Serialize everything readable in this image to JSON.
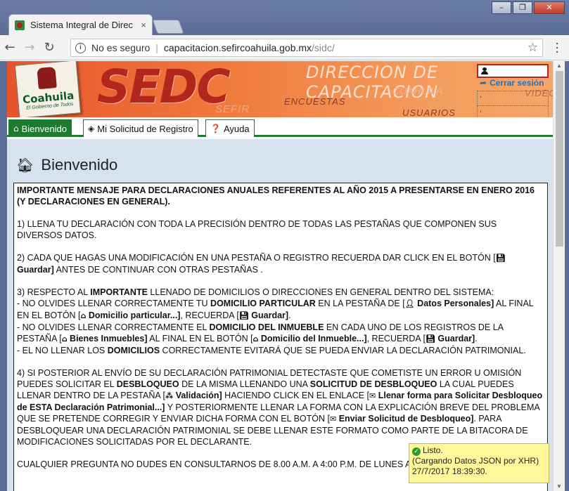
{
  "browser": {
    "tab_title": "Sistema Integral de Direc",
    "tab_close": "×",
    "security_label": "No es seguro",
    "url_host": "capacitacion.sefircoahuila.gob.mx",
    "url_path": "/sidc/",
    "window_minimize": "–",
    "window_restore": "❐",
    "window_close": "✕"
  },
  "banner": {
    "logo_text": "Coahuila",
    "logo_subtext": "El Gobierno de Todos",
    "app_name": "SEDC",
    "header_title": "DIRECCION DE CAPACITACION",
    "faint_label": "SEFIR",
    "faint_coahuila": "COAHUILA",
    "nav_encuestas": "ENCUESTAS",
    "nav_usuarios": "USUARIOS",
    "nav_videos": "VIDEOS",
    "logout_label": "Cerrar sesión",
    "box1_text": ",",
    "box2_text": ","
  },
  "tabs": [
    {
      "label": "Bienvenido",
      "icon": "home-icon"
    },
    {
      "label": "Mi Solicitud de Registro",
      "icon": "cube-icon"
    },
    {
      "label": "Ayuda",
      "icon": "question-circle-icon"
    }
  ],
  "page": {
    "heading": "Bienvenido"
  },
  "message": {
    "title": "IMPORTANTE MENSAJE PARA DECLARACIONES ANUALES REFERENTES AL AÑO 2015 A PRESENTARSE EN ENERO 2016 (Y DECLARACIONES EN GENERAL).",
    "p1": "1) LLENA TU DECLARACIÓN CON TODA LA PRECISIÓN DENTRO DE TODAS LAS PESTAÑAS QUE COMPONEN SUS DIVERSOS DATOS.",
    "p2a": "2) CADA QUE HAGAS UNA MODIFICACIÓN EN UNA PESTAÑA O REGISTRO RECUERDA DAR CLICK EN EL BOTÓN [",
    "p2b": "Guardar]",
    "p2c": " ANTES DE CONTINUAR CON OTRAS PESTAÑAS .",
    "p3a": "3) RESPECTO AL ",
    "p3b": "IMPORTANTE",
    "p3c": " LLENADO DE DOMICILIOS O DIRECCIONES EN GENERAL DENTRO DEL SISTEMA:",
    "p3d": "- NO OLVIDES LLENAR CORRECTAMENTE TU ",
    "p3e": "DOMICILIO PARTICULAR",
    "p3f": " EN LA PESTAÑA DE [",
    "p3g": " Datos Personales]",
    "p3h": " AL FINAL EN EL BOTÓN [",
    "p3i": " Domicilio particular...]",
    "p3j": ", RECUERDA [",
    "p3k": " Guardar]",
    "p3l": ".",
    "p3m": "- NO OLVIDES LLENAR CORRECTAMENTE EL ",
    "p3n": "DOMICILIO DEL INMUEBLE",
    "p3o": " EN CADA UNO DE LOS REGISTROS DE LA PESTAÑA [",
    "p3p": " Bienes Inmuebles]",
    "p3q": " AL FINAL EN EL BOTÓN [",
    "p3r": " Domicilio del Inmueble...]",
    "p3s": ", RECUERDA [",
    "p3t": " Guardar]",
    "p3u": ".",
    "p3v": "- EL NO LLENAR LOS ",
    "p3w": "DOMICILIOS",
    "p3x": " CORRECTAMENTE EVITARÁ QUE SE PUEDA ENVIAR LA DECLARACIÓN PATRIMONIAL.",
    "p4a": "4) SI POSTERIOR AL ENVÍO DE SU DECLARACIÓN PATRIMONIAL DETECTASTE QUE COMETISTE UN ERROR U OMISIÓN PUEDES SOLICITAR EL ",
    "p4b": "DESBLOQUEO",
    "p4c": " DE LA MISMA LLENANDO UNA ",
    "p4d": "SOLICITUD DE DESBLOQUEO",
    "p4e": " LA CUAL PUEDES LLENAR DENTRO DE LA PESTAÑA [",
    "p4f": " Validación]",
    "p4g": " HACIENDO CLICK EN EL ENLACE [",
    "p4h": " Llenar forma para Solicitar Desbloqueo de ESTA Declaración Patrimonial...]",
    "p4i": " Y POSTERIORMENTE LLENAR LA FORMA CON LA EXPLICACIÓN BREVE DEL PROBLEMA QUE SE PRETENDE CORREGIR Y ENVIAR DICHA FORMA CON EL BOTÓN [",
    "p4j": " Enviar Solicitud de Desbloqueo]",
    "p4k": ". PARA DESBLOQUEAR UNA DECLARACIÓN PATRIMONIAL SE DEBE LLENAR ESTE FORMATO COMO PARTE DE LA BITACORA DE MODIFICACIONES SOLICITADAS POR EL DECLARANTE.",
    "p5": "CUALQUIER PREGUNTA NO DUDES EN CONSULTARNOS DE 8.00 A.M. A 4:00 P.M. DE LUNES A VIERNES."
  },
  "status": {
    "line1": "Listo.",
    "line2": "(Cargando Datos JSON por XHR)",
    "line3": "27/7/2017 18:39:30."
  },
  "colors": {
    "tab_active": "#1d7a2e",
    "content_bg": "#d6e3ee",
    "status_bg": "#fff89a",
    "banner_red": "#b3261e"
  }
}
